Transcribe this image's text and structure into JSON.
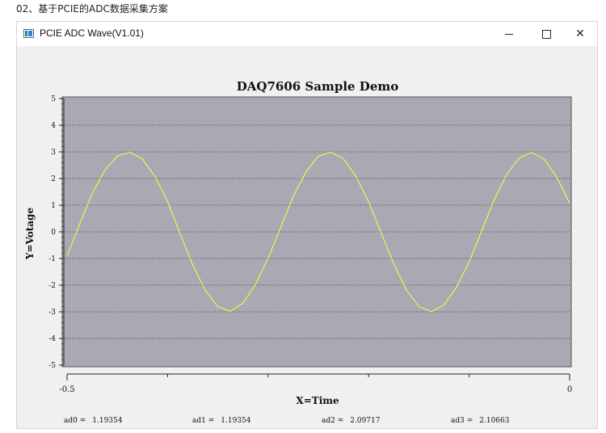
{
  "page": {
    "caption": "02、基于PCIE的ADC数据采集方案"
  },
  "window": {
    "title": "PCIE ADC Wave(V1.01)",
    "controls": {
      "minimize": "minimize-icon",
      "maximize": "maximize-icon",
      "close": "close-icon"
    }
  },
  "status": [
    {
      "label": "ad0 =",
      "value": "1.19354"
    },
    {
      "label": "ad1 =",
      "value": "1.19354"
    },
    {
      "label": "ad2 =",
      "value": "2.09717"
    },
    {
      "label": "ad3 =",
      "value": "2.10663"
    }
  ],
  "colors": {
    "plot_bg": "#a9a9b4",
    "wave": "#ffff33",
    "window_bg": "#f0f0f0"
  },
  "chart_data": {
    "type": "line",
    "title": "DAQ7606 Sample Demo",
    "xlabel": "X=Time",
    "ylabel": "Y=Votage",
    "xlim": [
      -0.5,
      0
    ],
    "ylim": [
      -5,
      5
    ],
    "x_tick_labels": [
      "-0.5",
      "0"
    ],
    "y_tick_labels": [
      "5",
      "4",
      "3",
      "2",
      "1",
      "0",
      "-1",
      "-2",
      "-3",
      "-4",
      "-5"
    ],
    "grid": true,
    "series": [
      {
        "x": [
          -0.5,
          -0.4875,
          -0.475,
          -0.4625,
          -0.45,
          -0.4375,
          -0.425,
          -0.4125,
          -0.4,
          -0.3875,
          -0.375,
          -0.3625,
          -0.35,
          -0.3375,
          -0.325,
          -0.3125,
          -0.3,
          -0.2875,
          -0.275,
          -0.2625,
          -0.25,
          -0.2375,
          -0.225,
          -0.2125,
          -0.2,
          -0.1875,
          -0.175,
          -0.1625,
          -0.15,
          -0.1375,
          -0.125,
          -0.1125,
          -0.1,
          -0.0875,
          -0.075,
          -0.0625,
          -0.05,
          -0.0375,
          -0.025,
          -0.0125,
          0
        ],
        "y": [
          -0.9,
          0.29,
          1.43,
          2.31,
          2.84,
          2.99,
          2.73,
          2.07,
          1.14,
          -0.06,
          -1.24,
          -2.2,
          -2.81,
          -2.98,
          -2.67,
          -1.97,
          -0.99,
          0.17,
          1.33,
          2.24,
          2.84,
          2.99,
          2.74,
          2.08,
          1.13,
          -0.04,
          -1.2,
          -2.18,
          -2.8,
          -3.0,
          -2.74,
          -2.08,
          -1.13,
          0.03,
          1.21,
          2.17,
          2.78,
          2.98,
          2.71,
          2.03,
          1.08
        ]
      }
    ]
  }
}
